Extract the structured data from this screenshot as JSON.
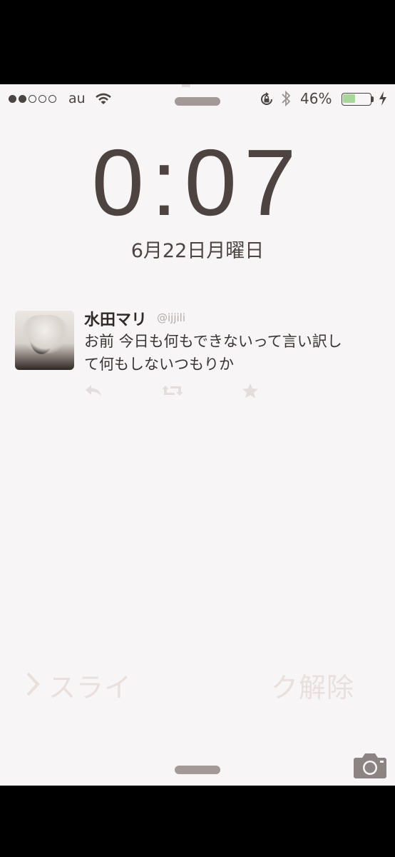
{
  "status_bar": {
    "carrier": "au",
    "battery_percent": "46%",
    "battery_level": 0.46,
    "signal_bars_filled": 2,
    "signal_bars_total": 5
  },
  "lock_screen": {
    "time": "0:07",
    "date": "6月22日月曜日",
    "unlock_text": "スライ　　　　　ク解除"
  },
  "notification": {
    "author": "水田マリ",
    "handle": "@ijjili",
    "text_line1": "お前 今日も何もできないって言い訳し",
    "text_line2": "て何もしないつもりか",
    "actions": [
      "reply-icon",
      "retweet-icon",
      "favorite-icon"
    ]
  },
  "colors": {
    "background": "#f7f5f5",
    "text": "#4d4442",
    "battery_fill": "#a8d79a"
  }
}
